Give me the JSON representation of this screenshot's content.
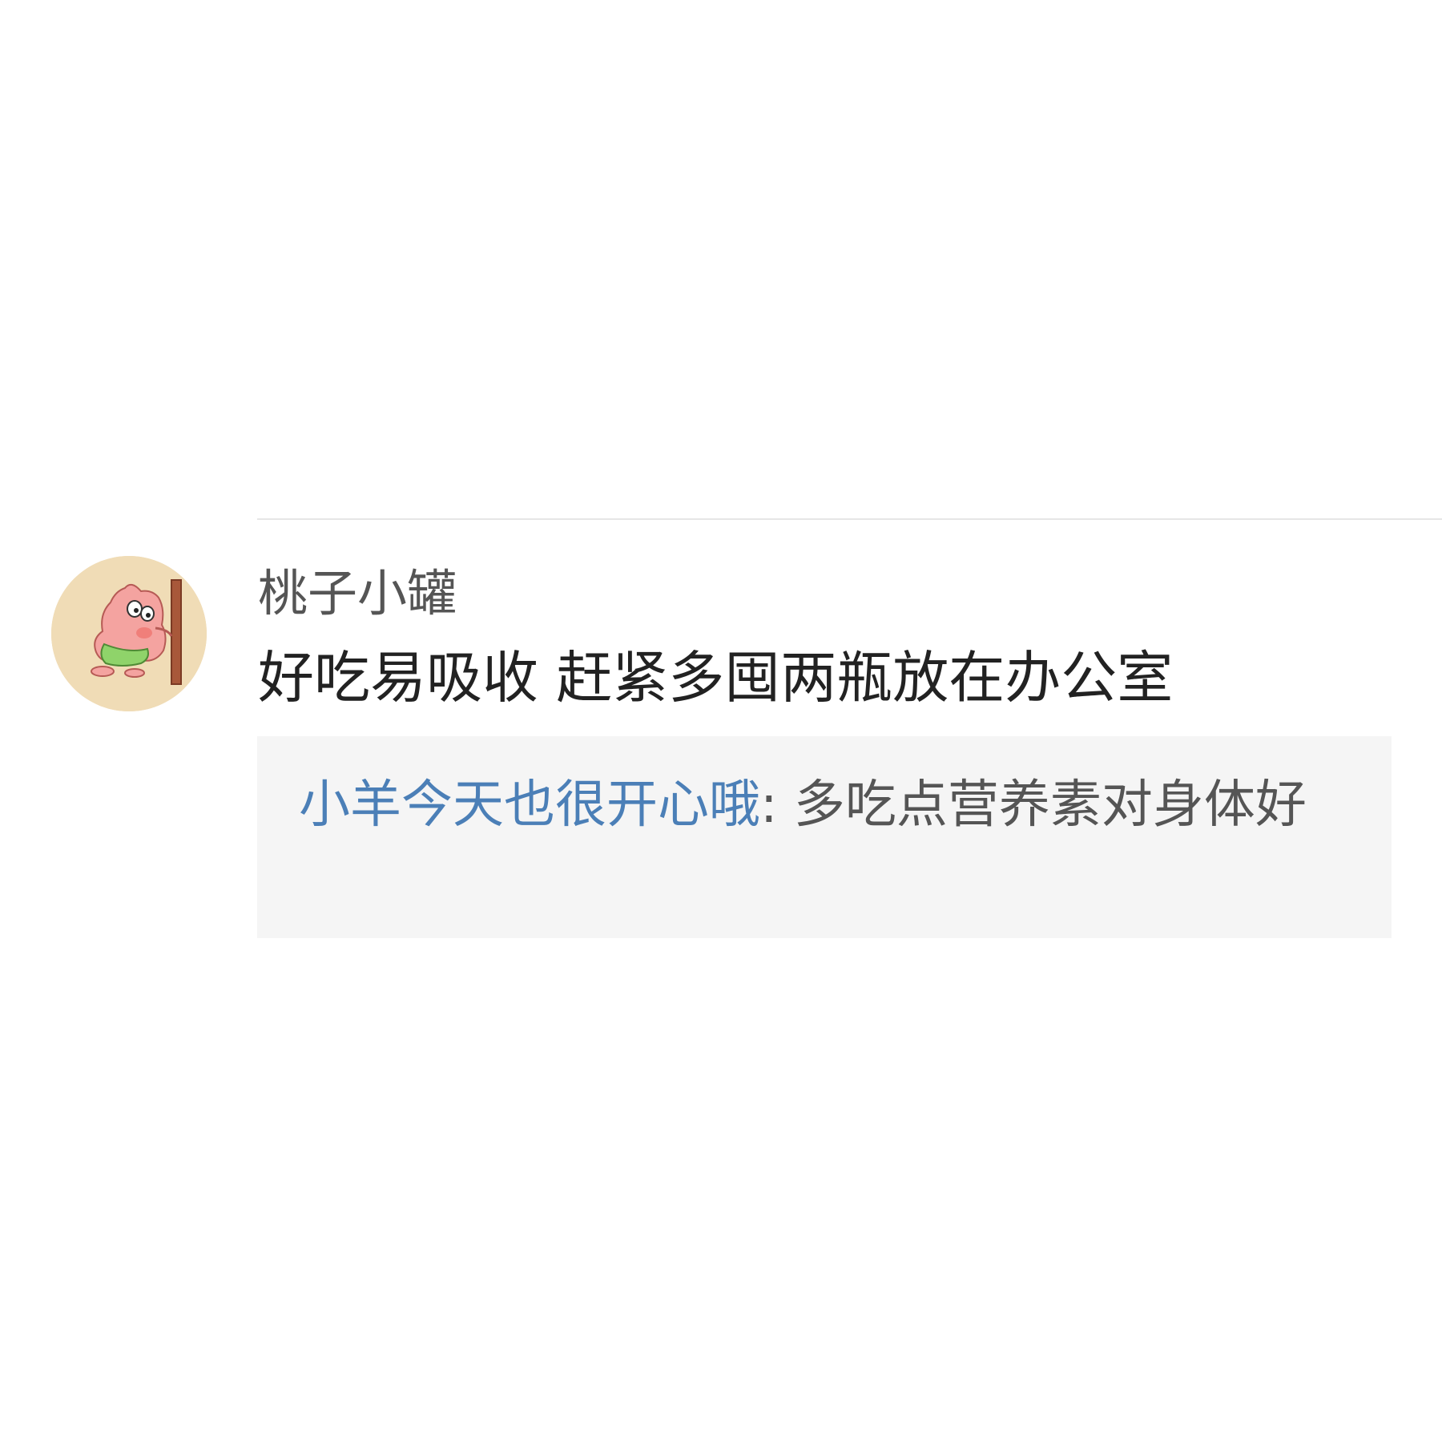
{
  "comment": {
    "avatar_icon": "patrick-star-avatar-icon",
    "username": "桃子小罐",
    "text": "好吃易吸收 赶紧多囤两瓶放在办公室",
    "reply": {
      "author": "小羊今天也很开心哦",
      "separator": ": ",
      "text": "多吃点营养素对身体好"
    }
  },
  "colors": {
    "reply_author": "#4b7fb7",
    "reply_background": "#f5f5f5",
    "divider": "#e6e6e6"
  }
}
